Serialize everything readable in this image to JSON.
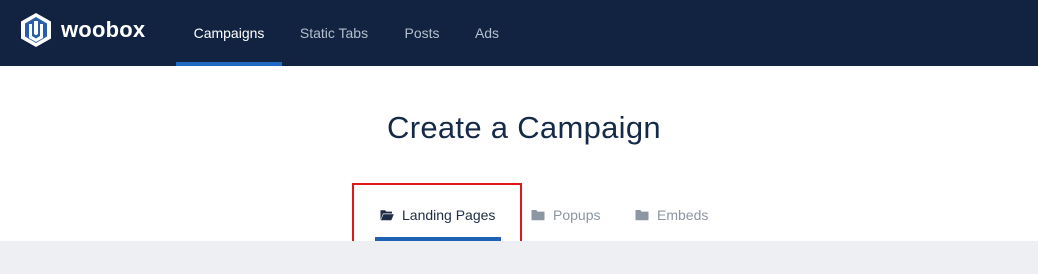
{
  "brand": {
    "name": "woobox"
  },
  "nav": {
    "items": [
      {
        "label": "Campaigns",
        "active": true
      },
      {
        "label": "Static Tabs",
        "active": false
      },
      {
        "label": "Posts",
        "active": false
      },
      {
        "label": "Ads",
        "active": false
      }
    ]
  },
  "page": {
    "title": "Create a Campaign"
  },
  "subtabs": {
    "items": [
      {
        "label": "Landing Pages",
        "icon": "folder-open-icon",
        "active": true
      },
      {
        "label": "Popups",
        "icon": "folder-icon",
        "active": false
      },
      {
        "label": "Embeds",
        "icon": "folder-icon",
        "active": false
      }
    ]
  },
  "colors": {
    "nav_background": "#112340",
    "accent": "#1f6bc2",
    "highlight": "#e3151b"
  }
}
